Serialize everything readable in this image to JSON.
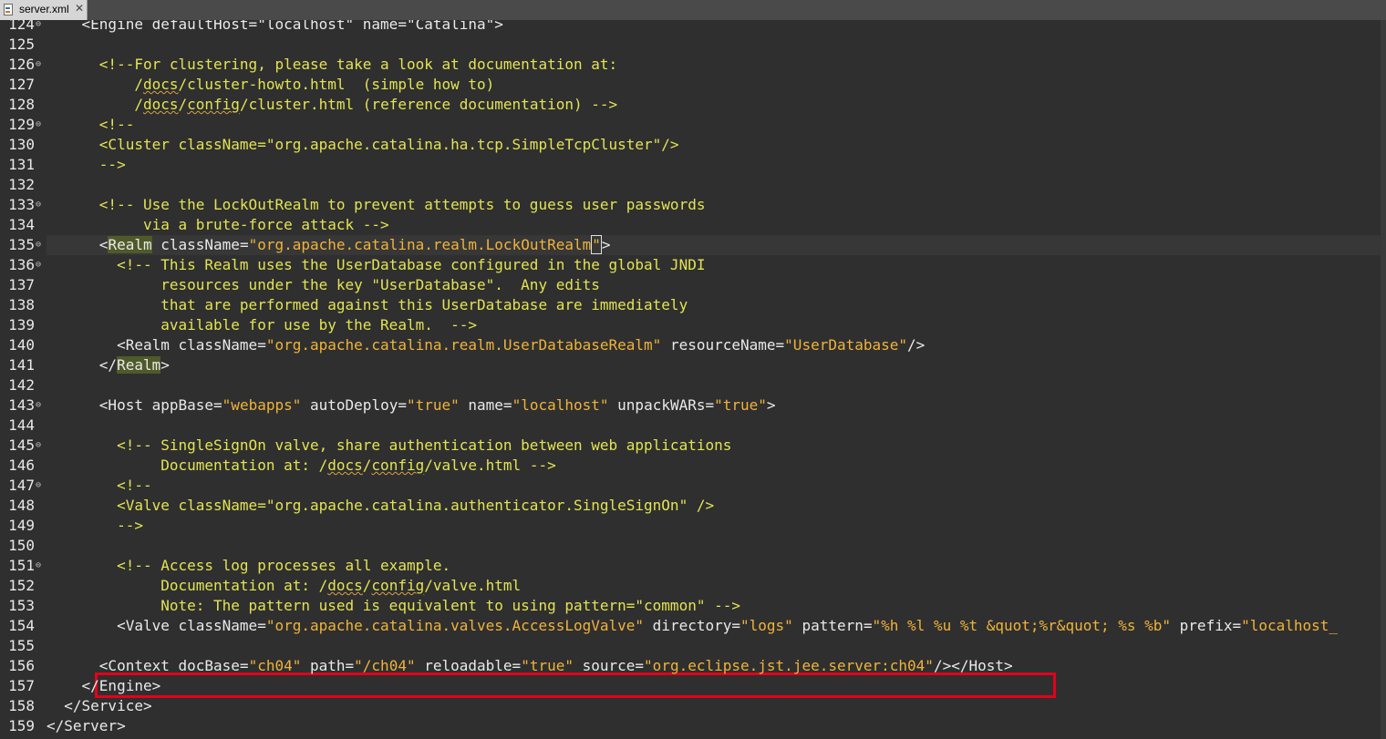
{
  "tab": {
    "title": "server.xml",
    "close": "✕"
  },
  "colors": {
    "background": "#2f2f2f",
    "comment": "#e3e354",
    "tag": "#e9e9e9",
    "string": "#f0b33a",
    "highlight_box": "#e3001b"
  },
  "lines": [
    {
      "num": "124",
      "fold": true,
      "parts": [
        [
          "tg",
          "    <Engine defaultHost=\"localhost\" name=\"Catalina\">"
        ]
      ]
    },
    {
      "num": "125",
      "fold": false,
      "parts": []
    },
    {
      "num": "126",
      "fold": true,
      "parts": [
        [
          "cm",
          "      <!--For clustering, please take a look at documentation at:"
        ]
      ]
    },
    {
      "num": "127",
      "fold": false,
      "parts": [
        [
          "cm",
          "          /"
        ],
        [
          "cm sq",
          "docs"
        ],
        [
          "cm",
          "/cluster-howto.html  (simple how to)"
        ]
      ]
    },
    {
      "num": "128",
      "fold": false,
      "parts": [
        [
          "cm",
          "          /"
        ],
        [
          "cm sq",
          "docs"
        ],
        [
          "cm",
          "/"
        ],
        [
          "cm sq",
          "config"
        ],
        [
          "cm",
          "/cluster.html (reference documentation) -->"
        ]
      ]
    },
    {
      "num": "129",
      "fold": true,
      "parts": [
        [
          "cm",
          "      <!--"
        ]
      ]
    },
    {
      "num": "130",
      "fold": false,
      "parts": [
        [
          "cm",
          "      <Cluster className=\"org.apache.catalina.ha.tcp.SimpleTcpCluster\"/>"
        ]
      ]
    },
    {
      "num": "131",
      "fold": false,
      "parts": [
        [
          "cm",
          "      -->"
        ]
      ]
    },
    {
      "num": "132",
      "fold": false,
      "parts": []
    },
    {
      "num": "133",
      "fold": true,
      "parts": [
        [
          "cm",
          "      <!-- Use the LockOutRealm to prevent attempts to guess user passwords"
        ]
      ]
    },
    {
      "num": "134",
      "fold": false,
      "parts": [
        [
          "cm",
          "           via a brute-force attack -->"
        ]
      ]
    },
    {
      "num": "135",
      "fold": true,
      "current": true,
      "parts": [
        [
          "tg",
          "      <"
        ],
        [
          "tg hl",
          "Realm"
        ],
        [
          "at",
          " className="
        ],
        [
          "st",
          "\"org.apache.catalina.realm.LockOutRealm"
        ],
        [
          "st caret",
          "\""
        ],
        [
          "tg",
          ">"
        ]
      ]
    },
    {
      "num": "136",
      "fold": true,
      "parts": [
        [
          "cm",
          "        <!-- This Realm uses the UserDatabase configured in the global JNDI"
        ]
      ]
    },
    {
      "num": "137",
      "fold": false,
      "parts": [
        [
          "cm",
          "             resources under the key \"UserDatabase\".  Any edits"
        ]
      ]
    },
    {
      "num": "138",
      "fold": false,
      "parts": [
        [
          "cm",
          "             that are performed against this UserDatabase are immediately"
        ]
      ]
    },
    {
      "num": "139",
      "fold": false,
      "parts": [
        [
          "cm",
          "             available for use by the Realm.  -->"
        ]
      ]
    },
    {
      "num": "140",
      "fold": false,
      "parts": [
        [
          "tg",
          "        <Realm"
        ],
        [
          "at",
          " className="
        ],
        [
          "st",
          "\"org.apache.catalina.realm.UserDatabaseRealm\""
        ],
        [
          "at",
          " resourceName="
        ],
        [
          "st",
          "\"UserDatabase\""
        ],
        [
          "tg",
          "/>"
        ]
      ]
    },
    {
      "num": "141",
      "fold": false,
      "parts": [
        [
          "tg",
          "      </"
        ],
        [
          "tg hl",
          "Realm"
        ],
        [
          "tg",
          ">"
        ]
      ]
    },
    {
      "num": "142",
      "fold": false,
      "parts": []
    },
    {
      "num": "143",
      "fold": true,
      "parts": [
        [
          "tg",
          "      <Host"
        ],
        [
          "at",
          " appBase="
        ],
        [
          "st",
          "\"webapps\""
        ],
        [
          "at",
          " autoDeploy="
        ],
        [
          "st",
          "\"true\""
        ],
        [
          "at",
          " name="
        ],
        [
          "st",
          "\"localhost\""
        ],
        [
          "at",
          " unpackWARs="
        ],
        [
          "st",
          "\"true\""
        ],
        [
          "tg",
          ">"
        ]
      ]
    },
    {
      "num": "144",
      "fold": false,
      "parts": []
    },
    {
      "num": "145",
      "fold": true,
      "parts": [
        [
          "cm",
          "        <!-- SingleSignOn valve, share authentication between web applications"
        ]
      ]
    },
    {
      "num": "146",
      "fold": false,
      "parts": [
        [
          "cm",
          "             Documentation at: /"
        ],
        [
          "cm sq",
          "docs"
        ],
        [
          "cm",
          "/"
        ],
        [
          "cm sq",
          "config"
        ],
        [
          "cm",
          "/valve.html -->"
        ]
      ]
    },
    {
      "num": "147",
      "fold": true,
      "parts": [
        [
          "cm",
          "        <!--"
        ]
      ]
    },
    {
      "num": "148",
      "fold": false,
      "parts": [
        [
          "cm",
          "        <Valve className=\"org.apache.catalina.authenticator.SingleSignOn\" />"
        ]
      ]
    },
    {
      "num": "149",
      "fold": false,
      "parts": [
        [
          "cm",
          "        -->"
        ]
      ]
    },
    {
      "num": "150",
      "fold": false,
      "parts": []
    },
    {
      "num": "151",
      "fold": true,
      "parts": [
        [
          "cm",
          "        <!-- Access log processes all example."
        ]
      ]
    },
    {
      "num": "152",
      "fold": false,
      "parts": [
        [
          "cm",
          "             Documentation at: /"
        ],
        [
          "cm sq",
          "docs"
        ],
        [
          "cm",
          "/"
        ],
        [
          "cm sq",
          "config"
        ],
        [
          "cm",
          "/valve.html"
        ]
      ]
    },
    {
      "num": "153",
      "fold": false,
      "parts": [
        [
          "cm",
          "             Note: The pattern used is equivalent to using pattern=\"common\" -->"
        ]
      ]
    },
    {
      "num": "154",
      "fold": false,
      "parts": [
        [
          "tg",
          "        <Valve"
        ],
        [
          "at",
          " className="
        ],
        [
          "st",
          "\"org.apache.catalina.valves.AccessLogValve\""
        ],
        [
          "at",
          " directory="
        ],
        [
          "st",
          "\"logs\""
        ],
        [
          "at",
          " pattern="
        ],
        [
          "st",
          "\"%h %l %u %t &quot;%r&quot; %s %b\""
        ],
        [
          "at",
          " prefix="
        ],
        [
          "st",
          "\"localhost_"
        ]
      ]
    },
    {
      "num": "155",
      "fold": false,
      "parts": []
    },
    {
      "num": "156",
      "fold": false,
      "boxed": true,
      "parts": [
        [
          "tg",
          "      <Context"
        ],
        [
          "at",
          " docBase="
        ],
        [
          "st",
          "\"ch04\""
        ],
        [
          "at",
          " path="
        ],
        [
          "st",
          "\"/ch04\""
        ],
        [
          "at",
          " reloadable="
        ],
        [
          "st",
          "\"true\""
        ],
        [
          "at",
          " source="
        ],
        [
          "st",
          "\"org.eclipse.jst.jee.server:ch04\""
        ],
        [
          "tg",
          "/></Host>"
        ]
      ]
    },
    {
      "num": "157",
      "fold": false,
      "parts": [
        [
          "tg",
          "    </Engine>"
        ]
      ]
    },
    {
      "num": "158",
      "fold": false,
      "parts": [
        [
          "tg",
          "  </Service>"
        ]
      ]
    },
    {
      "num": "159",
      "fold": false,
      "parts": [
        [
          "tg",
          "</Server>"
        ]
      ]
    }
  ]
}
